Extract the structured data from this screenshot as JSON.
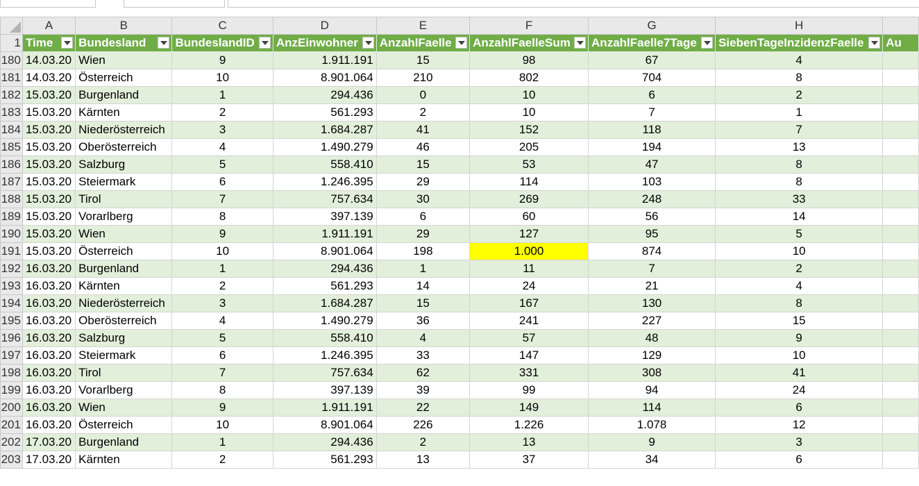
{
  "columns": [
    "A",
    "B",
    "C",
    "D",
    "E",
    "F",
    "G",
    "H"
  ],
  "header_row_number": "1",
  "headers": [
    "Time",
    "Bundesland",
    "BundeslandID",
    "AnzEinwohner",
    "AnzahlFaelle",
    "AnzahlFaelleSum",
    "AnzahlFaelle7Tage",
    "SiebenTageInzidenzFaelle",
    "Au"
  ],
  "highlight_color": "#ffff00",
  "header_color": "#70ad47",
  "band_color": "#e2efda",
  "rows": [
    {
      "n": "180",
      "c": [
        "14.03.20",
        "Wien",
        "9",
        "1.911.191",
        "15",
        "98",
        "67",
        "4"
      ]
    },
    {
      "n": "181",
      "c": [
        "14.03.20",
        "Österreich",
        "10",
        "8.901.064",
        "210",
        "802",
        "704",
        "8"
      ]
    },
    {
      "n": "182",
      "c": [
        "15.03.20",
        "Burgenland",
        "1",
        "294.436",
        "0",
        "10",
        "6",
        "2"
      ]
    },
    {
      "n": "183",
      "c": [
        "15.03.20",
        "Kärnten",
        "2",
        "561.293",
        "2",
        "10",
        "7",
        "1"
      ]
    },
    {
      "n": "184",
      "c": [
        "15.03.20",
        "Niederösterreich",
        "3",
        "1.684.287",
        "41",
        "152",
        "118",
        "7"
      ]
    },
    {
      "n": "185",
      "c": [
        "15.03.20",
        "Oberösterreich",
        "4",
        "1.490.279",
        "46",
        "205",
        "194",
        "13"
      ]
    },
    {
      "n": "186",
      "c": [
        "15.03.20",
        "Salzburg",
        "5",
        "558.410",
        "15",
        "53",
        "47",
        "8"
      ]
    },
    {
      "n": "187",
      "c": [
        "15.03.20",
        "Steiermark",
        "6",
        "1.246.395",
        "29",
        "114",
        "103",
        "8"
      ]
    },
    {
      "n": "188",
      "c": [
        "15.03.20",
        "Tirol",
        "7",
        "757.634",
        "30",
        "269",
        "248",
        "33"
      ]
    },
    {
      "n": "189",
      "c": [
        "15.03.20",
        "Vorarlberg",
        "8",
        "397.139",
        "6",
        "60",
        "56",
        "14"
      ]
    },
    {
      "n": "190",
      "c": [
        "15.03.20",
        "Wien",
        "9",
        "1.911.191",
        "29",
        "127",
        "95",
        "5"
      ]
    },
    {
      "n": "191",
      "c": [
        "15.03.20",
        "Österreich",
        "10",
        "8.901.064",
        "198",
        "1.000",
        "874",
        "10"
      ],
      "hl": 5
    },
    {
      "n": "192",
      "c": [
        "16.03.20",
        "Burgenland",
        "1",
        "294.436",
        "1",
        "11",
        "7",
        "2"
      ]
    },
    {
      "n": "193",
      "c": [
        "16.03.20",
        "Kärnten",
        "2",
        "561.293",
        "14",
        "24",
        "21",
        "4"
      ]
    },
    {
      "n": "194",
      "c": [
        "16.03.20",
        "Niederösterreich",
        "3",
        "1.684.287",
        "15",
        "167",
        "130",
        "8"
      ]
    },
    {
      "n": "195",
      "c": [
        "16.03.20",
        "Oberösterreich",
        "4",
        "1.490.279",
        "36",
        "241",
        "227",
        "15"
      ]
    },
    {
      "n": "196",
      "c": [
        "16.03.20",
        "Salzburg",
        "5",
        "558.410",
        "4",
        "57",
        "48",
        "9"
      ]
    },
    {
      "n": "197",
      "c": [
        "16.03.20",
        "Steiermark",
        "6",
        "1.246.395",
        "33",
        "147",
        "129",
        "10"
      ]
    },
    {
      "n": "198",
      "c": [
        "16.03.20",
        "Tirol",
        "7",
        "757.634",
        "62",
        "331",
        "308",
        "41"
      ]
    },
    {
      "n": "199",
      "c": [
        "16.03.20",
        "Vorarlberg",
        "8",
        "397.139",
        "39",
        "99",
        "94",
        "24"
      ]
    },
    {
      "n": "200",
      "c": [
        "16.03.20",
        "Wien",
        "9",
        "1.911.191",
        "22",
        "149",
        "114",
        "6"
      ]
    },
    {
      "n": "201",
      "c": [
        "16.03.20",
        "Österreich",
        "10",
        "8.901.064",
        "226",
        "1.226",
        "1.078",
        "12"
      ]
    },
    {
      "n": "202",
      "c": [
        "17.03.20",
        "Burgenland",
        "1",
        "294.436",
        "2",
        "13",
        "9",
        "3"
      ]
    },
    {
      "n": "203",
      "c": [
        "17.03.20",
        "Kärnten",
        "2",
        "561.293",
        "13",
        "37",
        "34",
        "6"
      ]
    }
  ]
}
